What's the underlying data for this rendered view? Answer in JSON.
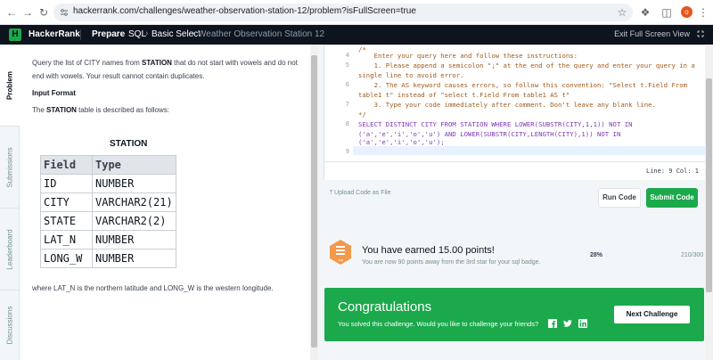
{
  "browser": {
    "url": "hackerrank.com/challenges/weather-observation-station-12/problem?isFullScreen=true",
    "avatar_letter": "o"
  },
  "nav": {
    "logo_letter": "H",
    "brand": "HackerRank",
    "prepare": "Prepare",
    "crumb_sql": "SQL",
    "crumb_basic_select": "Basic Select",
    "crumb_current": "Weather Observation Station 12",
    "exit_fullscreen": "Exit Full Screen View"
  },
  "tabs": [
    "Problem",
    "Submissions",
    "Leaderboard",
    "Discussions"
  ],
  "problem": {
    "desc_line1_a": "Query the list of CITY names from ",
    "desc_line1_b": "STATION",
    "desc_line1_c": " that do not start with vowels and do not",
    "desc_line2": "end with vowels. Your result cannot contain duplicates.",
    "input_format": "Input Format",
    "table_intro_a": "The ",
    "table_intro_b": "STATION",
    "table_intro_c": " table is described as follows:",
    "table_title": "STATION",
    "columns": [
      "Field",
      "Type"
    ],
    "rows": [
      [
        "ID",
        "NUMBER"
      ],
      [
        "CITY",
        "VARCHAR2(21)"
      ],
      [
        "STATE",
        "VARCHAR2(2)"
      ],
      [
        "LAT_N",
        "NUMBER"
      ],
      [
        "LONG_W",
        "NUMBER"
      ]
    ],
    "footer": "where LAT_N is the northern latitude and LONG_W is the western longitude."
  },
  "editor": {
    "lines": [
      {
        "n": "",
        "text": "/*",
        "cls": "cm"
      },
      {
        "n": "4",
        "text": "    Enter your query here and follow these instructions:",
        "cls": "cm"
      },
      {
        "n": "5",
        "text": "    1. Please append a semicolon \";\" at the end of the query and enter your query in a",
        "cls": "cm"
      },
      {
        "n": "",
        "text": "single line to avoid error.",
        "cls": "cm"
      },
      {
        "n": "6",
        "text": "    2. The AS keyword causes errors, so follow this convention: \"Select t.Field From",
        "cls": "cm"
      },
      {
        "n": "",
        "text": "table1 t\" instead of \"select t.Field From table1 AS t\"",
        "cls": "cm"
      },
      {
        "n": "7",
        "text": "    3. Type your code immediately after comment. Don't leave any blank line.",
        "cls": "cm"
      },
      {
        "n": "",
        "text": "*/",
        "cls": "cm"
      },
      {
        "n": "8",
        "text": "SELECT DISTINCT CITY FROM STATION WHERE LOWER(SUBSTR(CITY,1,1)) NOT IN",
        "cls": "kw"
      },
      {
        "n": "",
        "text": "('a','e','i','o','u') AND LOWER(SUBSTR(CITY,LENGTH(CITY),1)) NOT IN",
        "cls": "kw"
      },
      {
        "n": "",
        "text": "('a','e','i','o','u');",
        "cls": "kw"
      },
      {
        "n": "9",
        "text": "",
        "cls": "kw"
      }
    ],
    "status": "Line: 9 Col: 1"
  },
  "actions": {
    "upload": "Upload Code as File",
    "run": "Run Code",
    "submit": "Submit Code"
  },
  "progress": {
    "title": "You have earned 15.00 points!",
    "subtitle": "You are now 90 points away from the 3rd star for your sql badge.",
    "percent": "28%",
    "score": "210/300",
    "badge_label": "sql",
    "badge_color": "#f2994a"
  },
  "congrats": {
    "title": "Congratulations",
    "subtitle": "You solved this challenge. Would you like to challenge your friends?",
    "next": "Next Challenge",
    "color": "#1ba94c"
  }
}
